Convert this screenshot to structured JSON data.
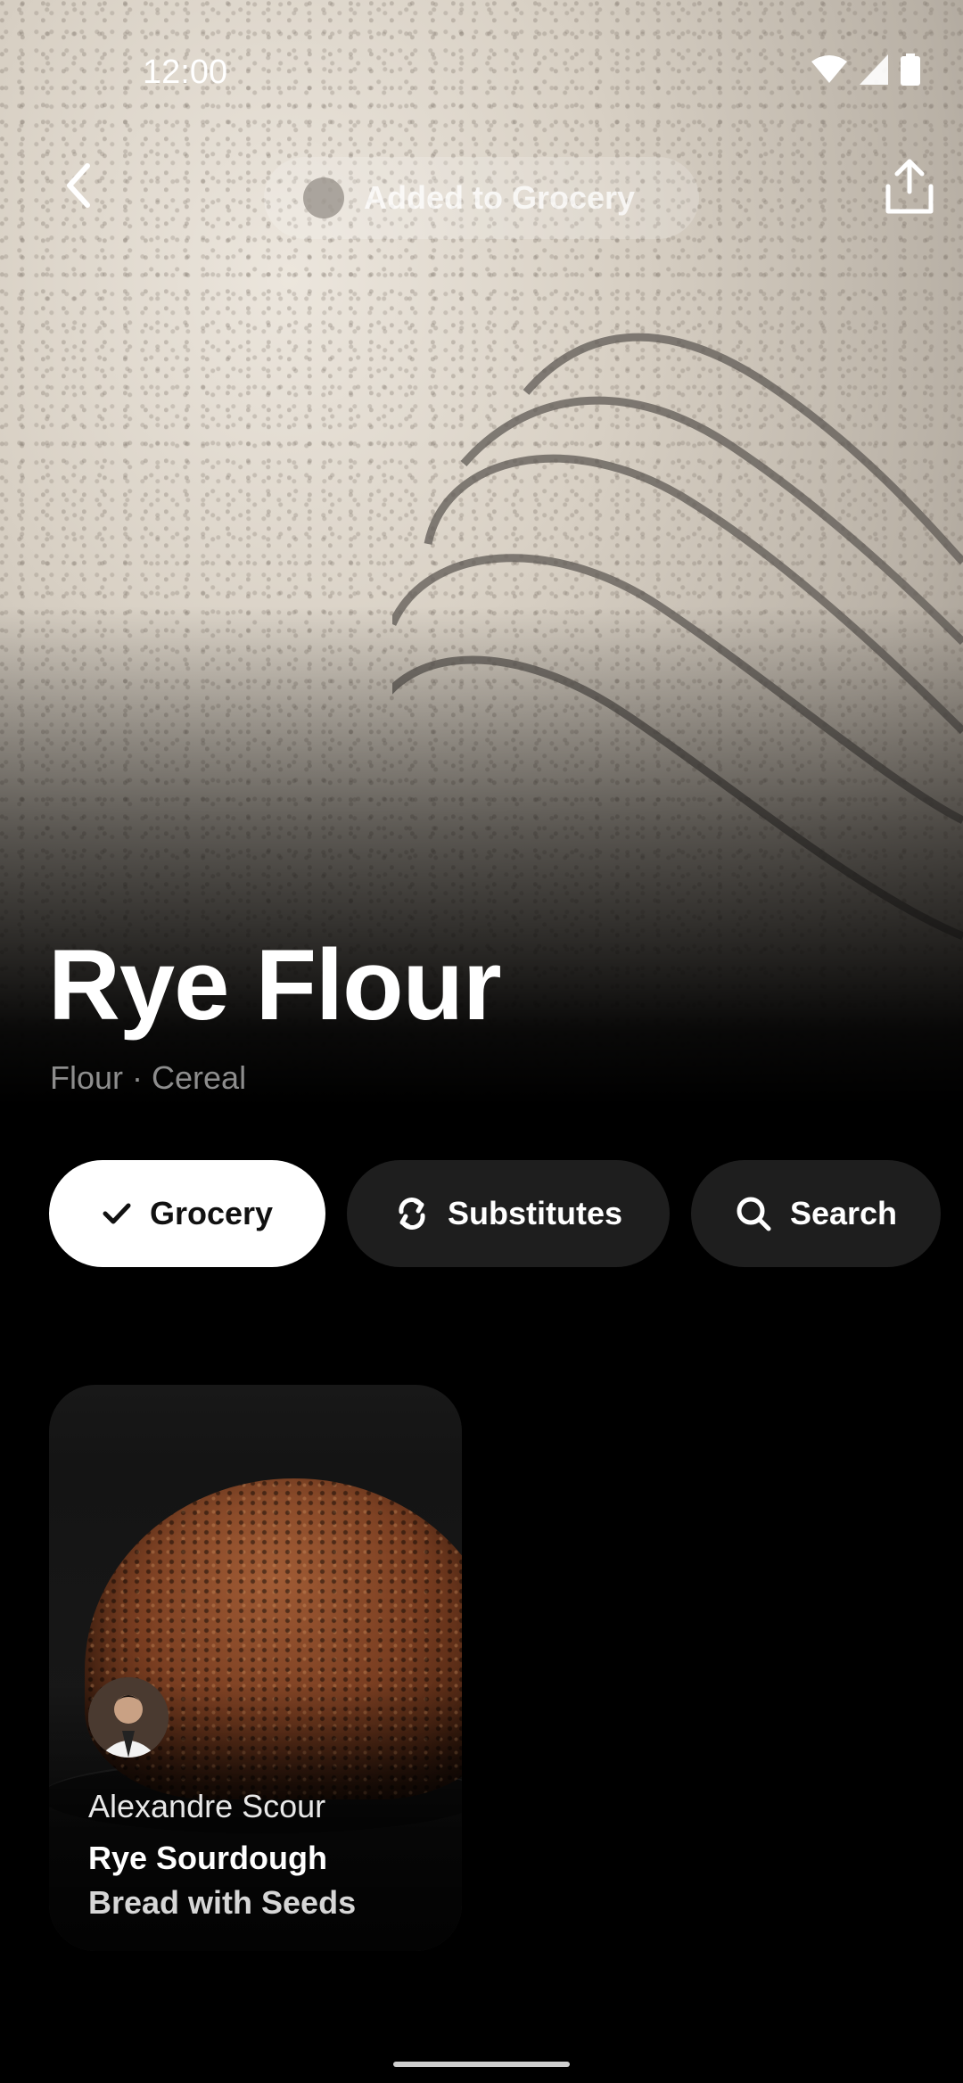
{
  "status_bar": {
    "time": "12:00",
    "icons": [
      "wifi-icon",
      "cellular-signal-icon",
      "battery-icon"
    ]
  },
  "top_bar": {
    "back_icon": "chevron-left-icon",
    "toast_text": "Added to Grocery",
    "share_icon": "share-upload-icon"
  },
  "ingredient": {
    "name": "Rye Flour",
    "categories": "Flour · Cereal"
  },
  "actions": [
    {
      "label": "Grocery",
      "icon": "check-icon",
      "active": true
    },
    {
      "label": "Substitutes",
      "icon": "swap-arrows-icon",
      "active": false
    },
    {
      "label": "Search",
      "icon": "search-icon",
      "active": false
    }
  ],
  "recipes": [
    {
      "chef": "Alexandre Scour",
      "title_line1": "Rye Sourdough",
      "title_line2": "Bread with Seeds"
    }
  ],
  "colors": {
    "background": "#000000",
    "chip_active_bg": "#FFFFFF",
    "chip_bg": "#1E1E1E",
    "subtitle": "#8D8D8D"
  }
}
